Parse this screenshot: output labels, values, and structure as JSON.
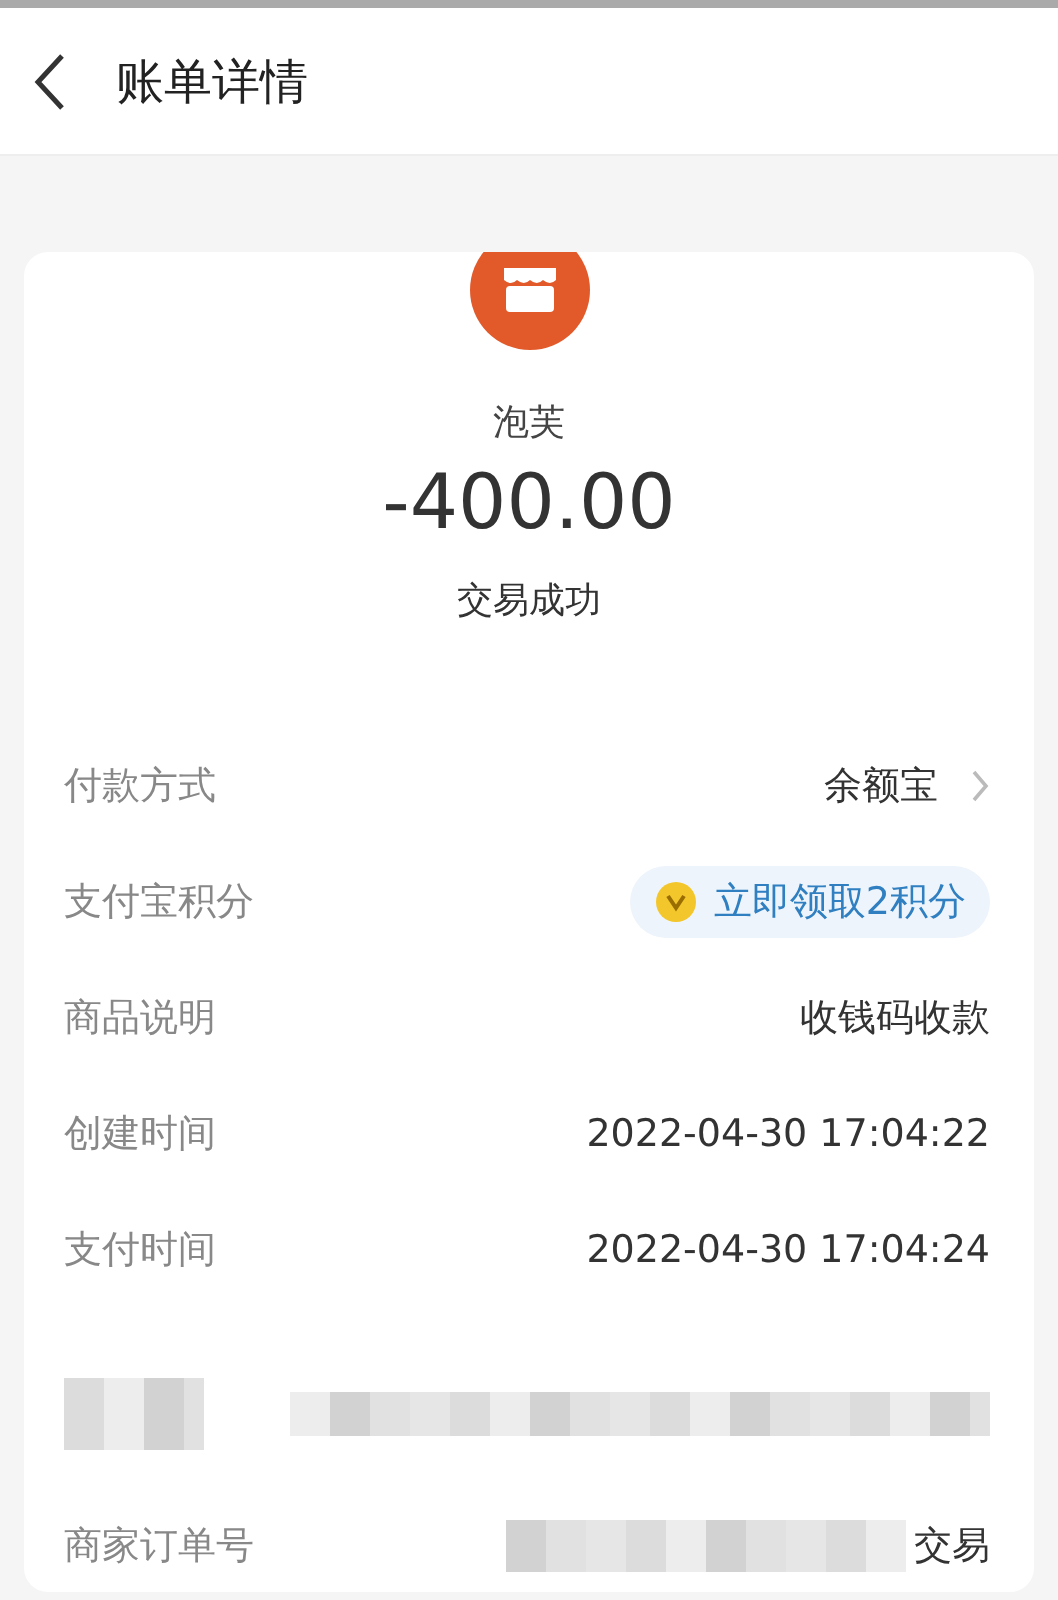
{
  "header": {
    "title": "账单详情"
  },
  "summary": {
    "merchant": "泡芙",
    "amount": "-400.00",
    "status": "交易成功"
  },
  "rows": [
    {
      "kind": "link",
      "label": "付款方式",
      "value": "余额宝"
    },
    {
      "kind": "points",
      "label": "支付宝积分",
      "value": "立即领取2积分"
    },
    {
      "kind": "plain",
      "label": "商品说明",
      "value": "收钱码收款"
    },
    {
      "kind": "plain",
      "label": "创建时间",
      "value": "2022-04-30 17:04:22"
    },
    {
      "kind": "plain",
      "label": "支付时间",
      "value": "2022-04-30 17:04:24"
    },
    {
      "kind": "redacted"
    },
    {
      "kind": "partial",
      "label": "商家订单号",
      "value": "交易"
    }
  ]
}
